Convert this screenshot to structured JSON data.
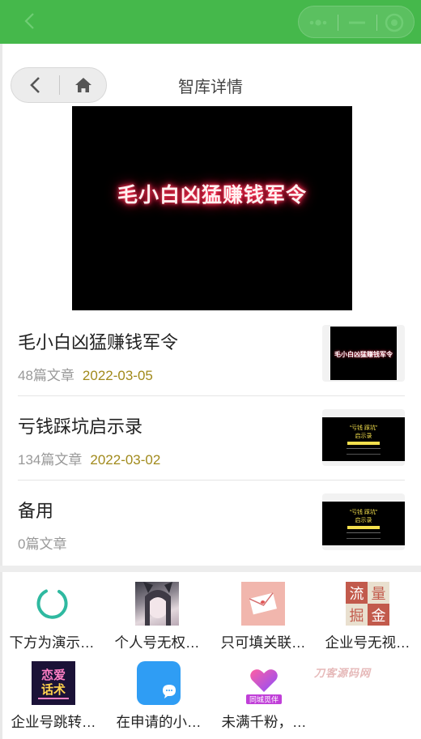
{
  "nav": {
    "title": "智库详情"
  },
  "cover": {
    "title": "毛小白凶猛赚钱军令"
  },
  "list": [
    {
      "title": "毛小白凶猛赚钱军令",
      "count": "48篇文章",
      "date": "2022-03-05",
      "thumb_text": "毛小白凶猛赚钱军令"
    },
    {
      "title": "亏钱踩坑启示录",
      "count": "134篇文章",
      "date": "2022-03-02",
      "thumb_text_1": "“亏钱 踩坑”",
      "thumb_text_2": "启示录"
    },
    {
      "title": "备用",
      "count": "0篇文章",
      "date": "",
      "thumb_text_1": "“亏钱 踩坑”",
      "thumb_text_2": "启示录"
    }
  ],
  "apps": [
    {
      "label": "下方为演示…",
      "icon": "loading-ring-icon"
    },
    {
      "label": "个人号无权…",
      "icon": "girl-avatar-icon"
    },
    {
      "label": "只可填关联…",
      "icon": "letter-envelope-icon"
    },
    {
      "label": "企业号无视…",
      "icon": "flow-gold-icon",
      "icon_text": [
        "流",
        "量",
        "掘",
        "金"
      ]
    },
    {
      "label": "企业号跳转…",
      "icon": "love-words-icon",
      "icon_text": [
        "恋爱",
        "话术"
      ]
    },
    {
      "label": "在申请的小…",
      "icon": "chat-bubble-icon"
    },
    {
      "label": "未满千粉，…",
      "icon": "heart-companion-icon",
      "icon_text": [
        "同城觅伴"
      ]
    }
  ],
  "watermark": "刀客源码网",
  "colors": {
    "topbar": "#45b84b",
    "date": "#a18a1c",
    "ring": "#2fb9a0"
  }
}
